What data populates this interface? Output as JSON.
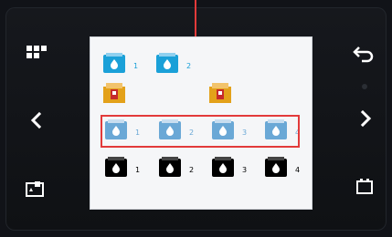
{
  "screen": {
    "top_row": [
      {
        "name": "ink-cartridge-1",
        "label": "1",
        "color": "#1aa0d8"
      },
      {
        "name": "ink-cartridge-2",
        "label": "2",
        "color": "#1aa0d8"
      }
    ],
    "waste_row": [
      {
        "name": "waste-tank-left",
        "label": "",
        "color": "#e3a11a"
      },
      {
        "name": "waste-tank-right",
        "label": "",
        "color": "#e3a11a"
      }
    ],
    "faded_row": [
      {
        "name": "ink-cartridge-faded-1",
        "label": "1",
        "color": "#6aa8d6"
      },
      {
        "name": "ink-cartridge-faded-2",
        "label": "2",
        "color": "#6aa8d6"
      },
      {
        "name": "ink-cartridge-faded-3",
        "label": "3",
        "color": "#6aa8d6"
      },
      {
        "name": "ink-cartridge-faded-4",
        "label": "4",
        "color": "#6aa8d6"
      }
    ],
    "black_row": [
      {
        "name": "ink-cartridge-black-1",
        "label": "1",
        "color": "#000000"
      },
      {
        "name": "ink-cartridge-black-2",
        "label": "2",
        "color": "#000000"
      },
      {
        "name": "ink-cartridge-black-3",
        "label": "3",
        "color": "#000000"
      },
      {
        "name": "ink-cartridge-black-4",
        "label": "4",
        "color": "#000000"
      }
    ]
  },
  "icons": {
    "menu": "grid-icon",
    "back": "back-arrow-icon",
    "left": "chevron-left-icon",
    "right": "chevron-right-icon",
    "maintenance": "cartridge-icon",
    "battery": "battery-icon"
  },
  "colors": {
    "highlight": "#e23a3a",
    "accent": "#1aa0d8"
  }
}
